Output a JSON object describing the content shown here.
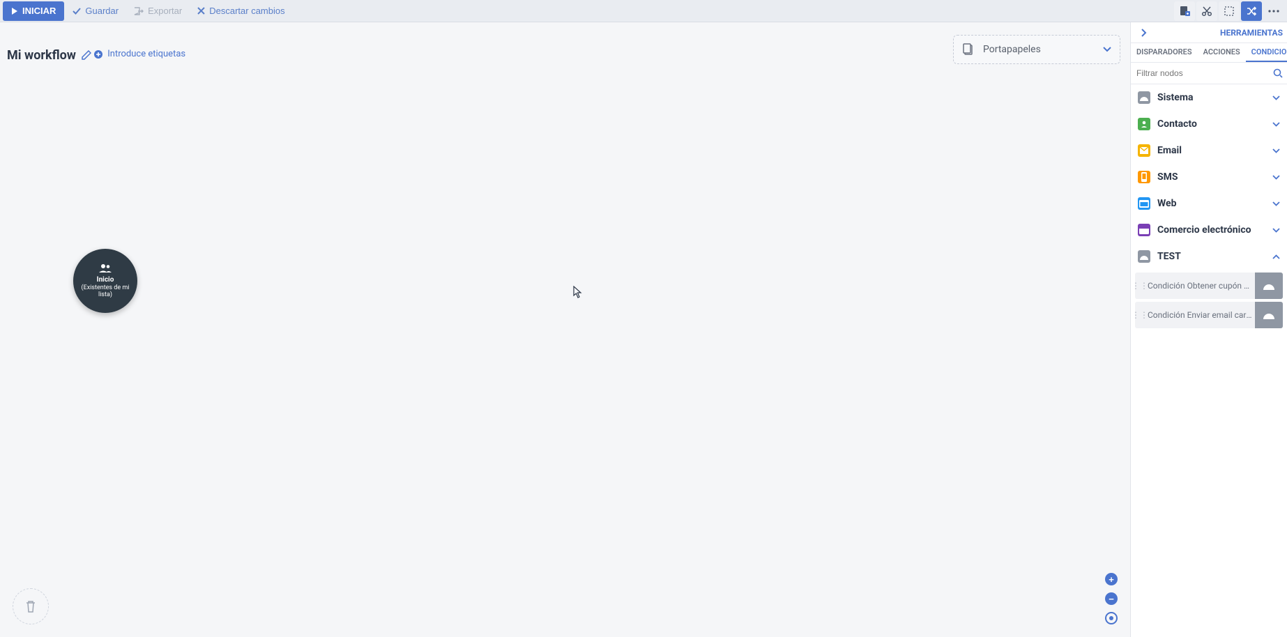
{
  "toolbar": {
    "start": "INICIAR",
    "save": "Guardar",
    "export": "Exportar",
    "discard": "Descartar cambios"
  },
  "workflow": {
    "title": "Mi workflow",
    "tags_label": "Introduce etiquetas",
    "clipboard": "Portapapeles",
    "start_node_title": "Inicio",
    "start_node_subtitle": "(Existentes de mi lista)"
  },
  "side": {
    "title": "HERRAMIENTAS",
    "tabs": {
      "triggers": "DISPARADORES",
      "actions": "ACCIONES",
      "conditions": "CONDICIONES"
    },
    "filter_placeholder": "Filtrar nodos",
    "categories": [
      {
        "label": "Sistema",
        "color": "ci-gray",
        "expanded": false
      },
      {
        "label": "Contacto",
        "color": "ci-green",
        "expanded": false
      },
      {
        "label": "Email",
        "color": "ci-yellow",
        "expanded": false
      },
      {
        "label": "SMS",
        "color": "ci-orange",
        "expanded": false
      },
      {
        "label": "Web",
        "color": "ci-blue",
        "expanded": false
      },
      {
        "label": "Comercio electrónico",
        "color": "ci-purple",
        "expanded": false
      },
      {
        "label": "TEST",
        "color": "ci-gray",
        "expanded": true
      }
    ],
    "test_nodes": [
      "Condición Obtener cupón per...",
      "Condición Enviar email carr..."
    ]
  }
}
